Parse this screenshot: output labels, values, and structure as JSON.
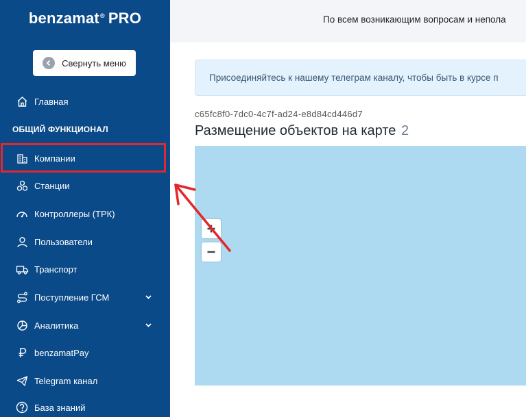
{
  "sidebar": {
    "logo_text": "benzamat",
    "logo_mark": "®",
    "logo_suffix": "PRO",
    "collapse_label": "Свернуть меню",
    "section_title": "ОБЩИЙ ФУНКЦИОНАЛ",
    "items": [
      {
        "label": "Главная",
        "icon": "home-icon"
      },
      {
        "label": "Компании",
        "icon": "building-icon"
      },
      {
        "label": "Станции",
        "icon": "stations-icon"
      },
      {
        "label": "Контроллеры (ТРК)",
        "icon": "gauge-icon"
      },
      {
        "label": "Пользователи",
        "icon": "user-icon"
      },
      {
        "label": "Транспорт",
        "icon": "truck-icon"
      },
      {
        "label": "Поступление ГСМ",
        "icon": "route-icon",
        "expandable": true
      },
      {
        "label": "Аналитика",
        "icon": "pie-chart-icon",
        "expandable": true
      },
      {
        "label": "benzamatPay",
        "icon": "ruble-icon"
      },
      {
        "label": "Telegram канал",
        "icon": "send-icon"
      },
      {
        "label": "База знаний",
        "icon": "help-icon"
      }
    ]
  },
  "header": {
    "notice": "По всем возникающим вопросам и непола"
  },
  "main": {
    "alert_text": "Присоединяйтесь к нашему телеграм каналу, чтобы быть в курсе п",
    "object_id": "c65fc8f0-7dc0-4c7f-ad24-e8d84cd446d7",
    "title": "Размещение объектов на карте",
    "count": "2",
    "map": {
      "zoom_in_label": "+",
      "zoom_out_label": "−"
    }
  },
  "colors": {
    "sidebar": "#0b4a88",
    "highlight": "#e5262b",
    "map_water": "#addaf1",
    "alert_bg": "#e4f2fd"
  }
}
